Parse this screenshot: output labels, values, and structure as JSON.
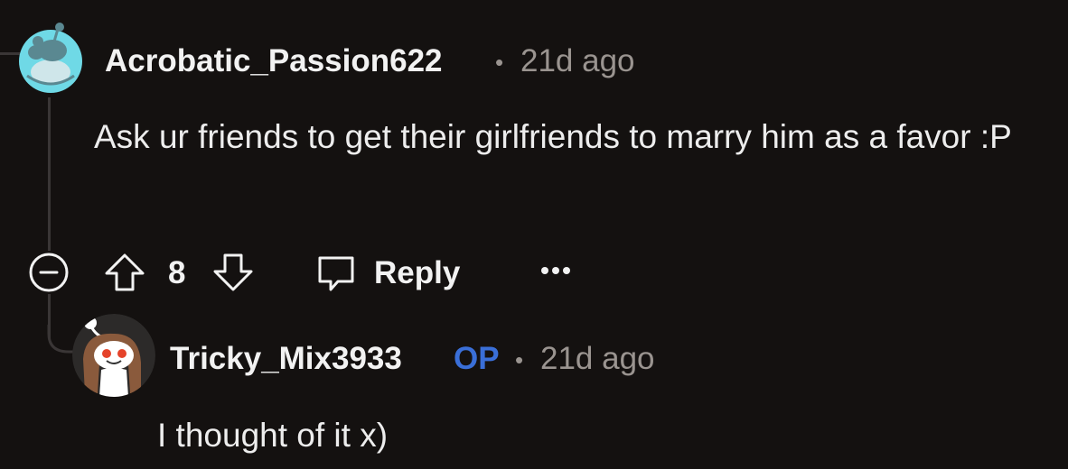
{
  "comment": {
    "author": "Acrobatic_Passion622",
    "separator": "•",
    "age": "21d ago",
    "text": "Ask ur friends to get their girlfriends to marry him as a favor :P",
    "vote_count": "8",
    "reply_label": "Reply",
    "more_label": "•••"
  },
  "reply": {
    "author": "Tricky_Mix3933",
    "op_badge": "OP",
    "separator": "•",
    "age": "21d ago",
    "text": "I thought of it x)"
  },
  "colors": {
    "background": "#141110",
    "text": "#f2f2f2",
    "muted": "#9a9490",
    "op_blue": "#3a6fd8",
    "thread_line": "#3a3636",
    "avatar1_bg": "#6fd9e6"
  },
  "icons": {
    "collapse": "minus-circle-icon",
    "upvote": "arrow-up-icon",
    "downvote": "arrow-down-icon",
    "reply": "speech-bubble-icon",
    "more": "ellipsis-icon"
  }
}
